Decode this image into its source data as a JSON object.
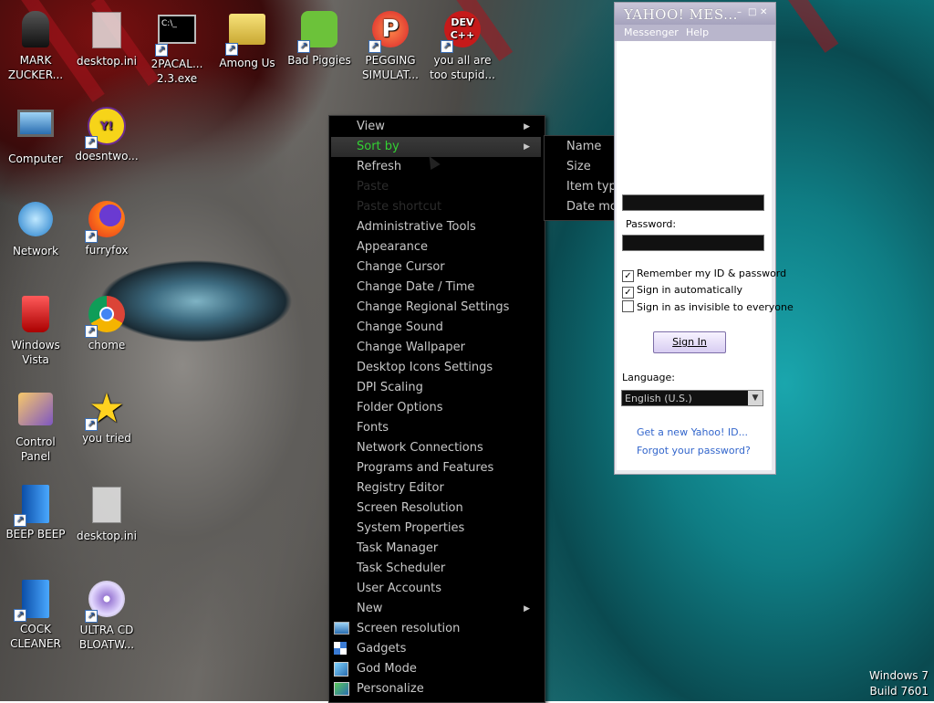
{
  "desktop_icons": [
    {
      "label": "MARK ZUCKER...",
      "icon": "person-icon",
      "shortcut": false
    },
    {
      "label": "desktop.ini",
      "icon": "file-icon",
      "shortcut": false
    },
    {
      "label": "2PACAL... 2.3.exe",
      "icon": "console-icon",
      "shortcut": true
    },
    {
      "label": "Among Us",
      "icon": "folder-icon",
      "shortcut": true
    },
    {
      "label": "Bad Piggies",
      "icon": "pig-icon",
      "shortcut": true
    },
    {
      "label": "PEGGING SIMULAT...",
      "icon": "p-logo-icon",
      "shortcut": true
    },
    {
      "label": "you all are too stupid...",
      "icon": "dev-cpp-icon",
      "shortcut": true
    },
    {
      "label": "Computer",
      "icon": "computer-icon",
      "shortcut": false
    },
    {
      "label": "doesntwo...",
      "icon": "yahoo-messenger-icon",
      "shortcut": true
    },
    {
      "label": "Network",
      "icon": "network-icon",
      "shortcut": false
    },
    {
      "label": "furryfox",
      "icon": "firefox-icon",
      "shortcut": true
    },
    {
      "label": "Windows Vista",
      "icon": "recycle-bin-icon",
      "shortcut": false
    },
    {
      "label": "chome",
      "icon": "chrome-icon",
      "shortcut": true
    },
    {
      "label": "Control Panel",
      "icon": "control-panel-icon",
      "shortcut": false
    },
    {
      "label": "you tried",
      "icon": "star-icon",
      "shortcut": true
    },
    {
      "label": "BEEP BEEP",
      "icon": "blue-book-icon",
      "shortcut": true
    },
    {
      "label": "desktop.ini",
      "icon": "file-icon",
      "shortcut": false
    },
    {
      "label": "COCK CLEANER",
      "icon": "blue-book-icon",
      "shortcut": true
    },
    {
      "label": "ULTRA CD BLOATW...",
      "icon": "cd-icon",
      "shortcut": true
    }
  ],
  "context_menu": {
    "items": [
      {
        "label": "View",
        "submenu": true,
        "state": "normal"
      },
      {
        "label": "Sort by",
        "submenu": true,
        "state": "highlighted"
      },
      {
        "label": "Refresh",
        "submenu": false,
        "state": "normal"
      },
      {
        "label": "Paste",
        "submenu": false,
        "state": "disabled"
      },
      {
        "label": "Paste shortcut",
        "submenu": false,
        "state": "disabled"
      },
      {
        "label": "Administrative Tools",
        "submenu": false,
        "state": "normal"
      },
      {
        "label": "Appearance",
        "submenu": false,
        "state": "normal"
      },
      {
        "label": "Change Cursor",
        "submenu": false,
        "state": "normal"
      },
      {
        "label": "Change Date / Time",
        "submenu": false,
        "state": "normal"
      },
      {
        "label": "Change Regional Settings",
        "submenu": false,
        "state": "normal"
      },
      {
        "label": "Change Sound",
        "submenu": false,
        "state": "normal"
      },
      {
        "label": "Change Wallpaper",
        "submenu": false,
        "state": "normal"
      },
      {
        "label": "Desktop Icons Settings",
        "submenu": false,
        "state": "normal"
      },
      {
        "label": "DPI Scaling",
        "submenu": false,
        "state": "normal"
      },
      {
        "label": "Folder Options",
        "submenu": false,
        "state": "normal"
      },
      {
        "label": "Fonts",
        "submenu": false,
        "state": "normal"
      },
      {
        "label": "Network Connections",
        "submenu": false,
        "state": "normal"
      },
      {
        "label": "Programs and Features",
        "submenu": false,
        "state": "normal"
      },
      {
        "label": "Registry Editor",
        "submenu": false,
        "state": "normal"
      },
      {
        "label": "Screen Resolution",
        "submenu": false,
        "state": "normal"
      },
      {
        "label": "System Properties",
        "submenu": false,
        "state": "normal"
      },
      {
        "label": "Task Manager",
        "submenu": false,
        "state": "normal"
      },
      {
        "label": "Task Scheduler",
        "submenu": false,
        "state": "normal"
      },
      {
        "label": "User Accounts",
        "submenu": false,
        "state": "normal"
      },
      {
        "label": "New",
        "submenu": true,
        "state": "normal"
      },
      {
        "label": "Screen resolution",
        "submenu": false,
        "state": "normal",
        "icon": "monitor-icon"
      },
      {
        "label": "Gadgets",
        "submenu": false,
        "state": "normal",
        "icon": "gadgets-icon"
      },
      {
        "label": "God Mode",
        "submenu": false,
        "state": "normal",
        "icon": "control-panel-icon"
      },
      {
        "label": "Personalize",
        "submenu": false,
        "state": "normal",
        "icon": "personalize-icon"
      }
    ],
    "highlight_color": "#33d133"
  },
  "sort_submenu": {
    "items": [
      "Name",
      "Size",
      "Item type",
      "Date modified"
    ]
  },
  "yahoo_window": {
    "title": "YAHOO! MES...",
    "menu": [
      "Messenger",
      "Help"
    ],
    "password_label": "Password:",
    "checkboxes": [
      {
        "label": "Remember my ID & password",
        "checked": true
      },
      {
        "label": "Sign in automatically",
        "checked": true
      },
      {
        "label": "Sign in as invisible to everyone",
        "checked": false
      }
    ],
    "sign_in_button": "Sign In",
    "language_label": "Language:",
    "language_value": "English (U.S.)",
    "links": [
      "Get a new Yahoo! ID...",
      "Forgot your password?"
    ]
  },
  "watermark": {
    "line1": "Windows 7",
    "line2": "Build 7601"
  }
}
